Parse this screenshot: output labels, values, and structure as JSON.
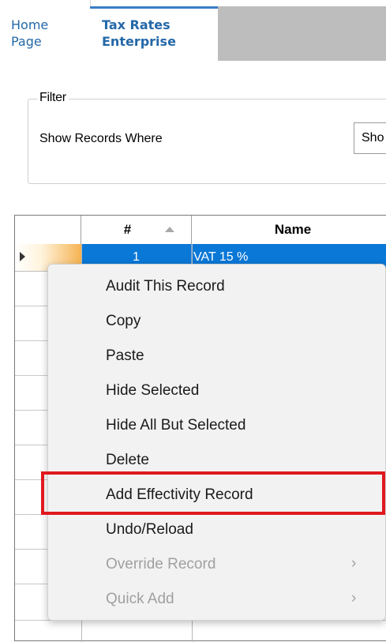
{
  "tabs": [
    {
      "label": "Home Page"
    },
    {
      "label": "Tax Rates Enterprise"
    }
  ],
  "filter": {
    "legend": "Filter",
    "label": "Show Records Where",
    "select_value": "Sho"
  },
  "grid": {
    "columns": [
      {
        "label": "#"
      },
      {
        "label": "Name"
      }
    ],
    "selected_row": {
      "number": "1",
      "name": "VAT 15 %"
    }
  },
  "context_menu": {
    "items": [
      {
        "label": "Audit This Record",
        "enabled": true
      },
      {
        "label": "Copy",
        "enabled": true
      },
      {
        "label": "Paste",
        "enabled": true
      },
      {
        "label": "Hide Selected",
        "enabled": true
      },
      {
        "label": "Hide All But Selected",
        "enabled": true
      },
      {
        "label": "Delete",
        "enabled": true
      },
      {
        "label": "Add Effectivity Record",
        "enabled": true,
        "highlighted": true
      },
      {
        "label": "Undo/Reload",
        "enabled": true
      },
      {
        "label": "Override Record",
        "enabled": false,
        "submenu": true
      },
      {
        "label": "Quick Add",
        "enabled": false,
        "submenu": true
      }
    ],
    "submenu_glyph": "›"
  },
  "colors": {
    "selection": "#0a78d7",
    "tab_accent": "#3a7dc7",
    "highlight": "#e0191e"
  }
}
